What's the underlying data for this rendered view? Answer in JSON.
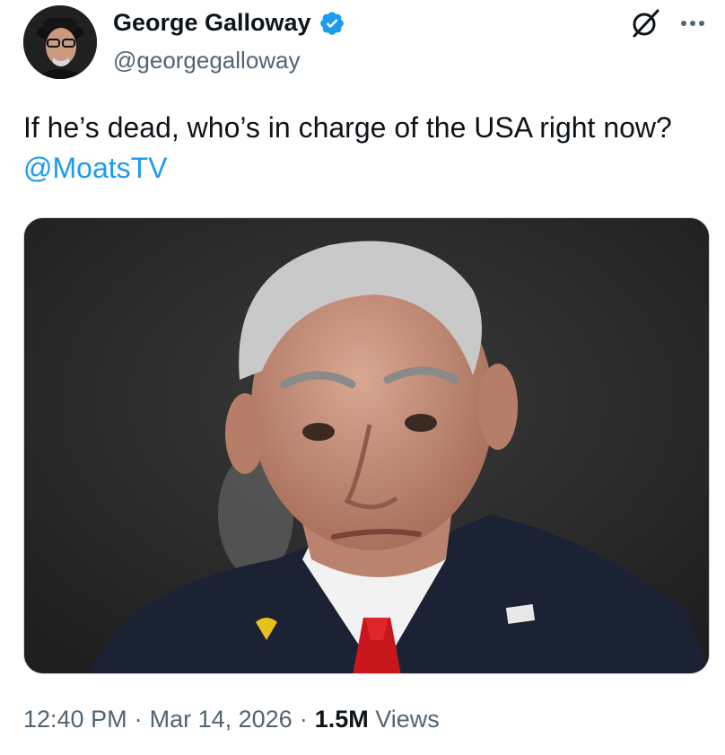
{
  "author": {
    "name": "George Galloway",
    "handle": "@georgegalloway",
    "verified": true
  },
  "tweet": {
    "text": "If he’s dead, who’s in charge of the USA right now? ",
    "mention": "@MoatsTV"
  },
  "meta": {
    "time": "12:40 PM",
    "separator1": "·",
    "date": "Mar 14, 2026",
    "separator2": "·",
    "views_count": "1.5M",
    "views_label": "Views"
  },
  "icons": {
    "grok": "grok-slash-circle-icon",
    "more": "more-dots-icon",
    "verified": "verified-badge-icon"
  },
  "colors": {
    "accent": "#1d9bf0",
    "secondary_text": "#536471",
    "primary_text": "#0f1419"
  }
}
